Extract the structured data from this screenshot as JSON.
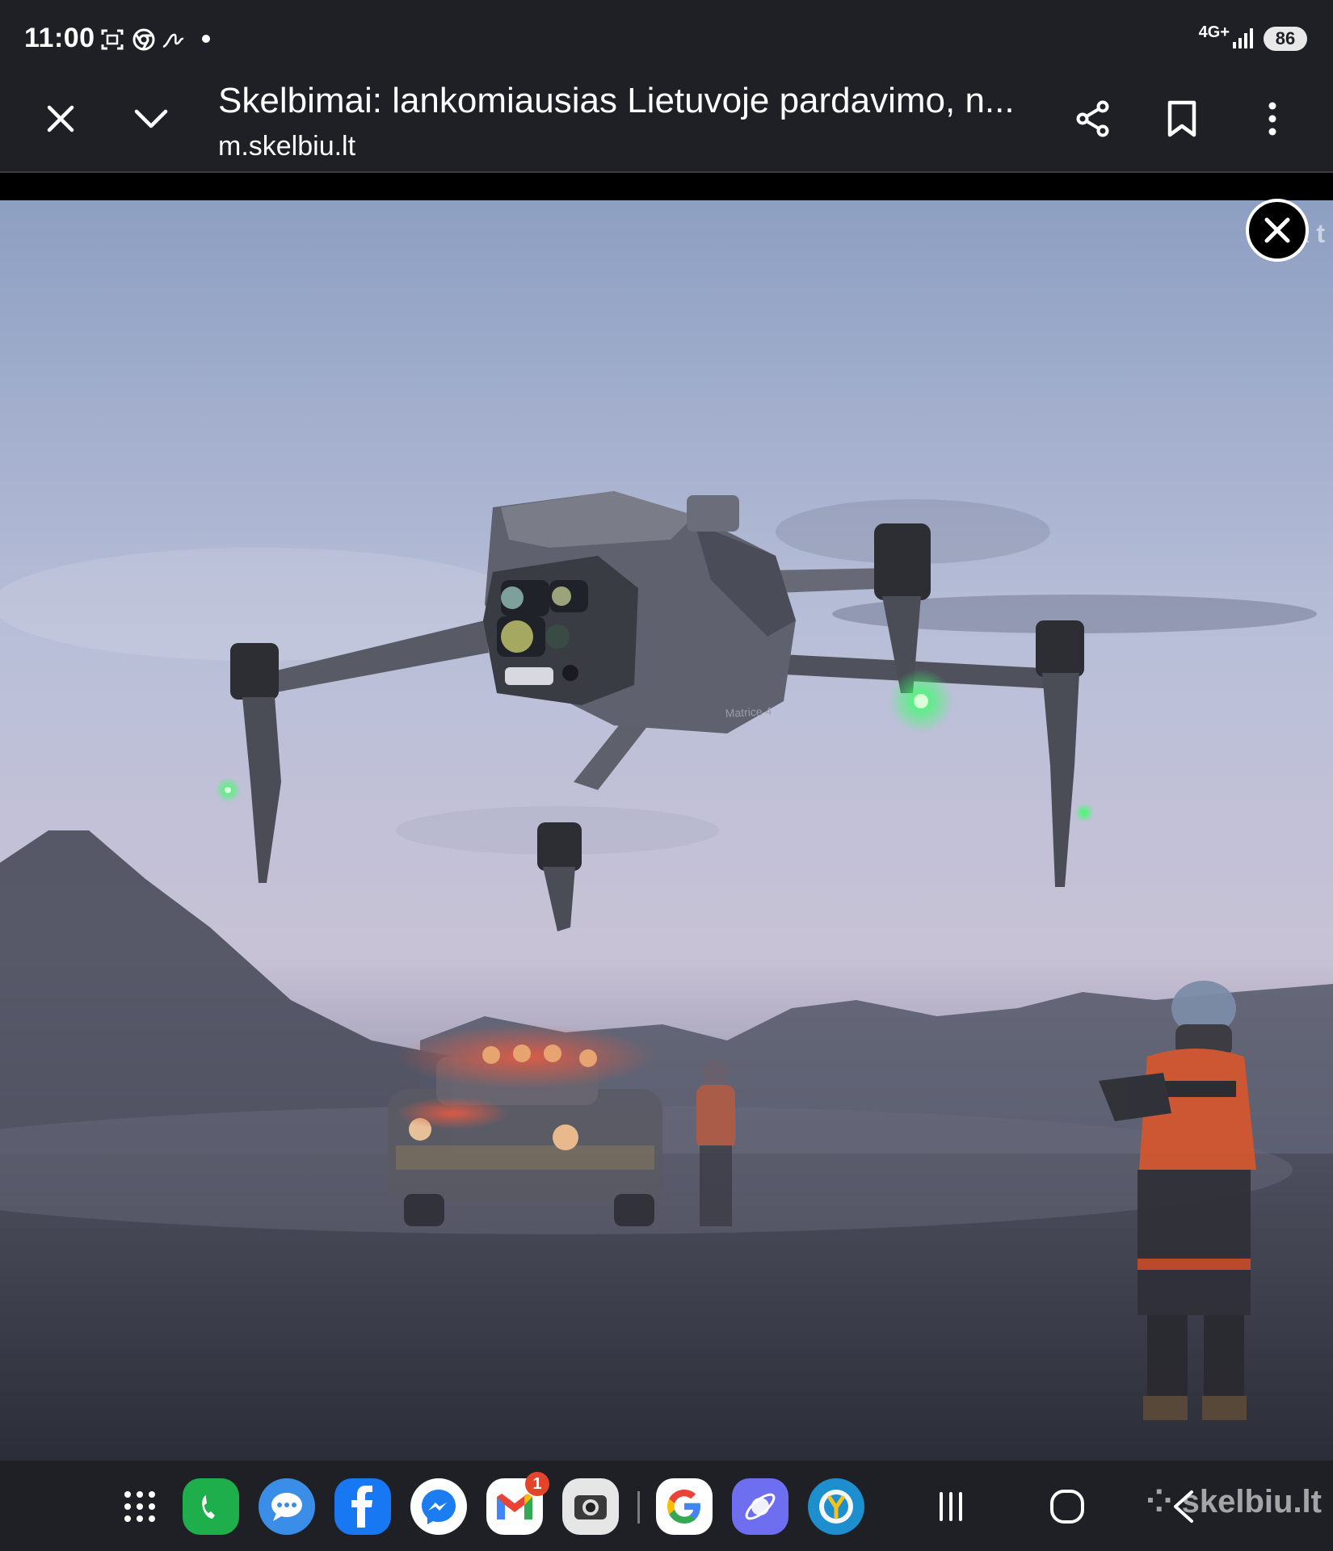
{
  "status_bar": {
    "time": "11:00",
    "network": "4G+",
    "battery": "86",
    "icons": [
      "screenshot-icon",
      "chrome-icon",
      "signature-icon",
      "notification-dot",
      "signal-icon"
    ]
  },
  "browser": {
    "page_title": "Skelbimai: lankomiausias Lietuvoje pardavimo, n...",
    "url": "m.skelbiu.lt",
    "icons": [
      "close-icon",
      "chevron-down-icon",
      "share-icon",
      "bookmark-icon",
      "more-vert-icon"
    ]
  },
  "photo": {
    "watermark": "sk        t",
    "drone_label": "Matrice 4",
    "close_icon": "close-icon"
  },
  "dock": {
    "apps": [
      {
        "name": "apps-grid-icon"
      },
      {
        "name": "phone-icon",
        "color": "#1fae4c"
      },
      {
        "name": "messages-icon",
        "color": "#3a8ee8"
      },
      {
        "name": "facebook-icon",
        "color": "#1877f2"
      },
      {
        "name": "messenger-icon",
        "color": "#ffffff"
      },
      {
        "name": "gmail-icon",
        "badge": "1"
      },
      {
        "name": "camera-icon",
        "color": "#e6e6e6"
      },
      {
        "name": "google-icon",
        "color": "#ffffff"
      },
      {
        "name": "orbit-icon",
        "color": "#6d6ff0"
      },
      {
        "name": "yoyo-icon",
        "color": "#1d8fcf"
      }
    ],
    "nav": [
      "recents-icon",
      "home-icon",
      "back-icon"
    ],
    "watermark": "skelbiu.lt"
  }
}
